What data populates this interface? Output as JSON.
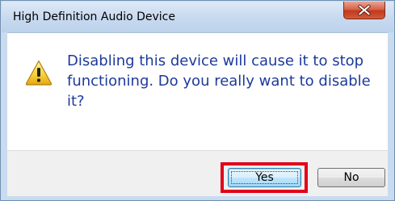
{
  "dialog": {
    "title": "High Definition Audio Device",
    "close_icon": "close-x-icon",
    "message_icon": "warning-icon",
    "message": "Disabling this device will cause it to stop functioning. Do you really want to disable it?",
    "buttons": {
      "yes_label": "Yes",
      "no_label": "No"
    },
    "highlighted_button": "Yes",
    "colors": {
      "message_text": "#1d3a9b",
      "highlight_border": "#e2001a",
      "close_button": "#c2391c"
    }
  }
}
